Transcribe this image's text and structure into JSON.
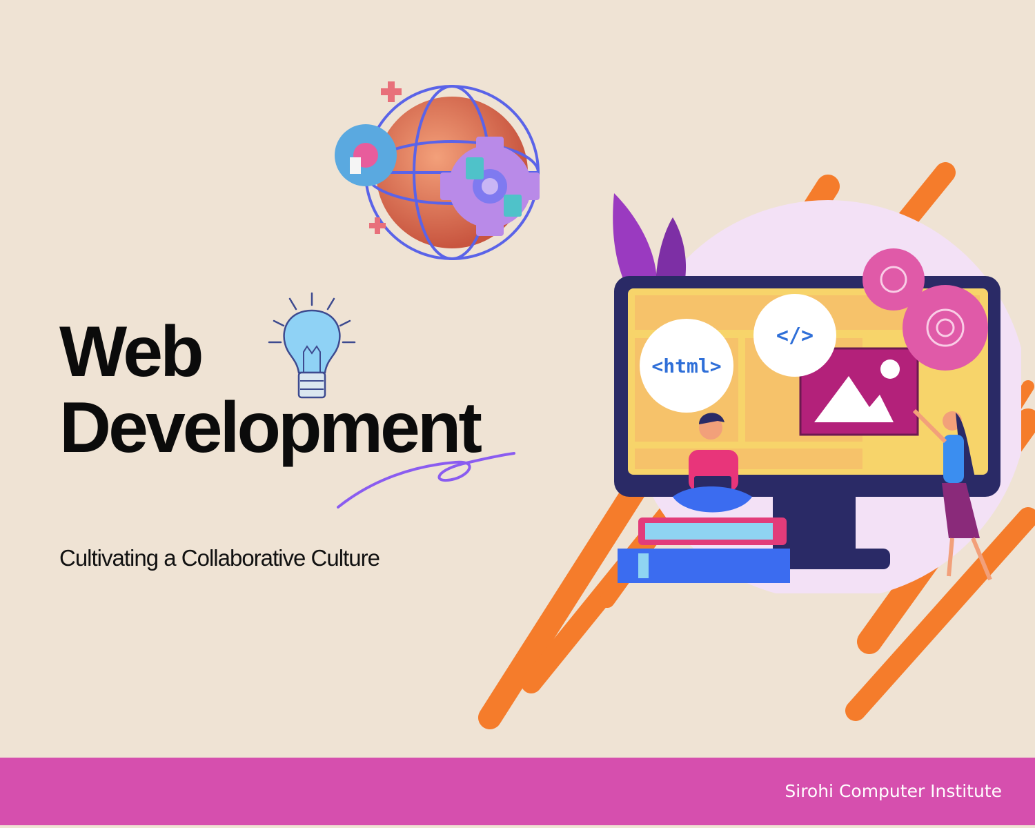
{
  "slide": {
    "title_line1": "Web",
    "title_line2": "Development",
    "subtitle": "Cultivating a Collaborative Culture",
    "footer_text": "Sirohi Computer Institute"
  },
  "illustration": {
    "bubble_html": "<html>",
    "bubble_code": "</>",
    "icons": [
      "globe-gears-icon",
      "lightbulb-icon",
      "monitor-icon",
      "gear-icon",
      "image-icon",
      "books-icon"
    ]
  },
  "colors": {
    "background": "#efe3d4",
    "footer": "#d64fae",
    "accent_orange": "#f57c2b",
    "accent_purple": "#8a5cf0",
    "title": "#0b0b0b"
  }
}
